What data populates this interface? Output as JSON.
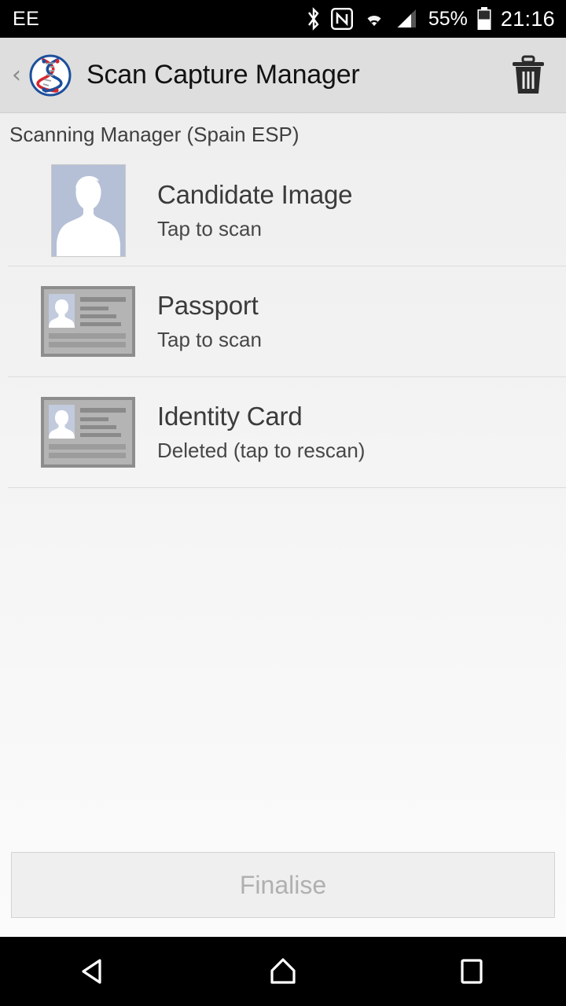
{
  "status_bar": {
    "carrier": "EE",
    "battery_percent": "55%",
    "time": "21:16",
    "icons": [
      "bluetooth-icon",
      "nfc-icon",
      "wifi-icon",
      "cellular-signal-icon",
      "battery-icon"
    ]
  },
  "app_bar": {
    "back_label": "‹",
    "logo_name": "dna-helix-logo",
    "title": "Scan Capture Manager",
    "delete_icon": "trash-icon"
  },
  "section": {
    "subtitle": "Scanning Manager (Spain ESP)"
  },
  "scan_items": [
    {
      "title": "Candidate Image",
      "status": "Tap to scan",
      "thumb": "person-avatar-thumbnail"
    },
    {
      "title": "Passport",
      "status": "Tap to scan",
      "thumb": "id-card-thumbnail"
    },
    {
      "title": "Identity Card",
      "status": "Deleted (tap to rescan)",
      "thumb": "id-card-thumbnail"
    }
  ],
  "footer": {
    "finalise_label": "Finalise",
    "finalise_enabled": false
  },
  "nav_bar": {
    "back": "back-triangle-icon",
    "home": "home-icon",
    "recents": "recents-square-icon"
  },
  "colors": {
    "app_bar_bg": "#dedede",
    "page_bg_top": "#ededed",
    "page_bg_bottom": "#fcfcfc",
    "title_text": "#3b3b3b",
    "avatar_bg": "#b5c0d6",
    "card_border": "#8d8d8d",
    "logo_blue": "#1c4f9c",
    "logo_red": "#d7262f",
    "disabled_text": "#b0b0b0"
  }
}
